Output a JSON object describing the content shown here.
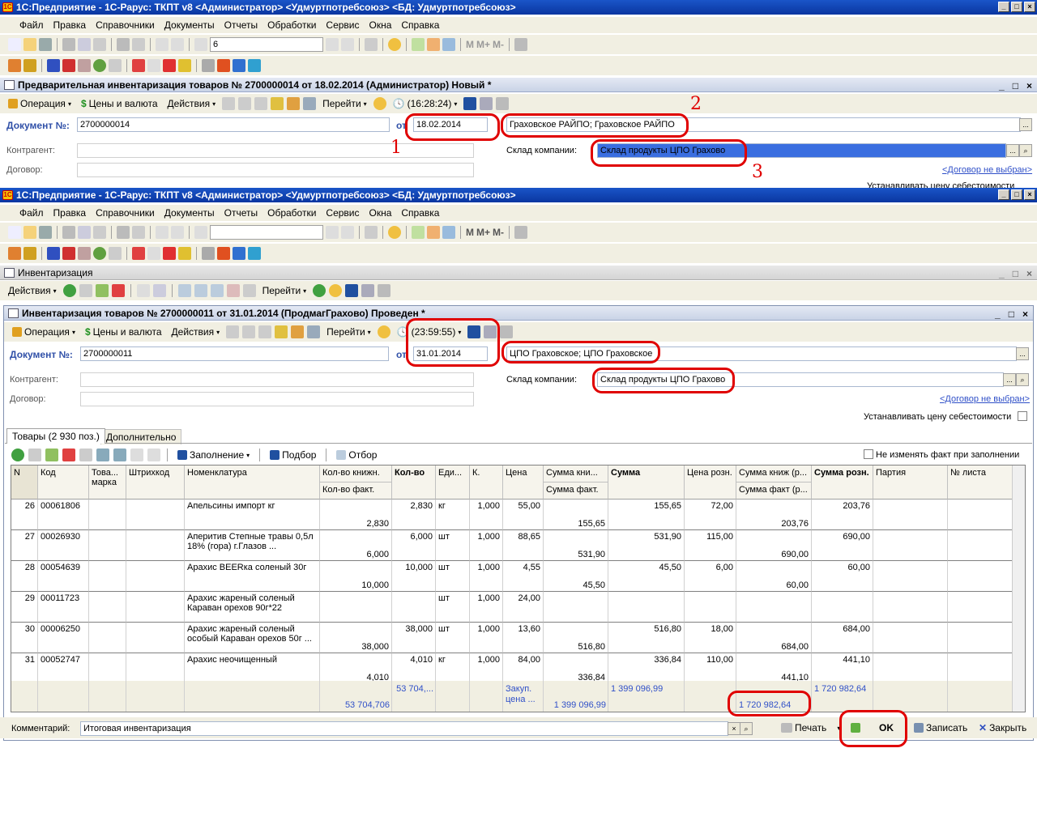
{
  "app": {
    "title1": "1С:Предприятие - 1С-Рарус: ТКПТ v8 <Администратор> <Удмуртпотребсоюз> <БД: Удмуртпотребсоюз>",
    "title2": "1С:Предприятие - 1С-Рарус: ТКПТ v8 <Администратор> <Удмуртпотребсоюз> <БД: Удмуртпотребсоюз>",
    "logo": "1С"
  },
  "menu": [
    "Файл",
    "Правка",
    "Справочники",
    "Документы",
    "Отчеты",
    "Обработки",
    "Сервис",
    "Окна",
    "Справка"
  ],
  "toolbar": {
    "combo1_value": "6",
    "m_labels": [
      "M",
      "M+",
      "M-"
    ]
  },
  "window_buttons": {
    "min": "_",
    "max": "□",
    "close": "×"
  },
  "doc1": {
    "title": "Предварительная инвентаризация товаров № 2700000014 от 18.02.2014 (Администратор) Новый *",
    "cmd": {
      "operation": "Операция",
      "prices": "Цены и валюта",
      "actions": "Действия",
      "goto": "Перейти",
      "time": "(16:28:24)"
    },
    "doc_label": "Документ №:",
    "doc_no": "2700000014",
    "from_label": "от",
    "date": "18.02.2014",
    "org": "Граховское РАЙПО; Граховское РАЙПО",
    "contractor_label": "Контрагент:",
    "contract_label": "Договор:",
    "warehouse_label": "Склад компании:",
    "warehouse": "Склад продукты ЦПО Грахово",
    "contract_link": "<Договор не выбран>",
    "cost_label": "Устанавливать цену себестоимости"
  },
  "annotations": {
    "n1": "1",
    "n2": "2",
    "n3": "3"
  },
  "list_window": {
    "title": "Инвентаризация",
    "actions": "Действия",
    "goto": "Перейти"
  },
  "doc2": {
    "title": "Инвентаризация товаров № 2700000011 от 31.01.2014 (ПродмагГрахово) Проведен *",
    "cmd": {
      "operation": "Операция",
      "prices": "Цены и валюта",
      "actions": "Действия",
      "goto": "Перейти",
      "time": "(23:59:55)"
    },
    "doc_label": "Документ №:",
    "doc_no": "2700000011",
    "from_label": "от",
    "date": "31.01.2014",
    "org": "ЦПО Граховское; ЦПО Граховское",
    "contractor_label": "Контрагент:",
    "contract_label": "Договор:",
    "warehouse_label": "Склад компании:",
    "warehouse": "Склад продукты ЦПО Грахово",
    "contract_link": "<Договор не выбран>",
    "cost_label": "Устанавливать цену себестоимости",
    "tabs": [
      "Товары (2 930 поз.)",
      "Дополнительно"
    ],
    "table_toolbar": {
      "fill": "Заполнение",
      "select": "Подбор",
      "filter": "Отбор",
      "no_change": "Не изменять факт при заполнении"
    },
    "columns": {
      "n": "N",
      "code": "Код",
      "mark": "Това... марка",
      "barcode": "Штрихкод",
      "nom": "Номенклатура",
      "qty_book": "Кол-во книжн.",
      "qty_fact": "Кол-во факт.",
      "qty": "Кол-во",
      "unit": "Еди...",
      "k": "К.",
      "price": "Цена",
      "sum_book": "Сумма кни...",
      "sum_fact": "Сумма факт.",
      "sum": "Сумма",
      "price_retail": "Цена розн.",
      "sum_book_r": "Сумма книж (р...",
      "sum_fact_r": "Сумма факт (р...",
      "sum_retail": "Сумма розн.",
      "batch": "Партия",
      "sheet": "№ листа"
    },
    "rows": [
      {
        "n": "26",
        "code": "00061806",
        "nom": "Апельсины импорт кг",
        "qty_book": "2,830",
        "qty": "2,830",
        "unit": "кг",
        "k": "1,000",
        "price": "55,00",
        "sum_book": "155,65",
        "sum": "155,65",
        "price_retail": "72,00",
        "sum_book_r": "203,76",
        "sum_retail": "203,76"
      },
      {
        "n": "27",
        "code": "00026930",
        "nom": "Аперитив Степные травы 0,5л 18% (гора) г.Глазов ...",
        "qty_book": "6,000",
        "qty": "6,000",
        "unit": "шт",
        "k": "1,000",
        "price": "88,65",
        "sum_book": "531,90",
        "sum": "531,90",
        "price_retail": "115,00",
        "sum_book_r": "690,00",
        "sum_retail": "690,00"
      },
      {
        "n": "28",
        "code": "00054639",
        "nom": "Арахис BEERка соленый 30г",
        "qty_book": "10,000",
        "qty": "10,000",
        "unit": "шт",
        "k": "1,000",
        "price": "4,55",
        "sum_book": "45,50",
        "sum": "45,50",
        "price_retail": "6,00",
        "sum_book_r": "60,00",
        "sum_retail": "60,00"
      },
      {
        "n": "29",
        "code": "00011723",
        "nom": "Арахис жареный соленый Караван орехов 90г*22",
        "qty_book": "",
        "qty": "",
        "unit": "шт",
        "k": "1,000",
        "price": "24,00",
        "sum_book": "",
        "sum": "",
        "price_retail": "",
        "sum_book_r": "",
        "sum_retail": ""
      },
      {
        "n": "30",
        "code": "00006250",
        "nom": "Арахис жареный соленый особый Караван орехов 50г ...",
        "qty_book": "38,000",
        "qty": "38,000",
        "unit": "шт",
        "k": "1,000",
        "price": "13,60",
        "sum_book": "516,80",
        "sum": "516,80",
        "price_retail": "18,00",
        "sum_book_r": "684,00",
        "sum_retail": "684,00"
      },
      {
        "n": "31",
        "code": "00052747",
        "nom": "Арахис неочищенный",
        "qty_book": "4,010",
        "qty": "4,010",
        "unit": "кг",
        "k": "1,000",
        "price": "84,00",
        "sum_book": "336,84",
        "sum": "336,84",
        "price_retail": "110,00",
        "sum_book_r": "441,10",
        "sum_retail": "441,10"
      }
    ],
    "footer": {
      "qty_top": "53 704,...",
      "qty_bottom": "53 704,706",
      "price_note": "Закуп. цена ...",
      "sum_book": "1 399 096,99",
      "sum": "1 399 096,99",
      "sum_fact_r": "1 720 982,64",
      "sum_retail": "1 720 982,64"
    },
    "comment_label": "Комментарий:",
    "comment": "Итоговая инвентаризация",
    "print": "Печать",
    "ok": "OK",
    "save": "Записать",
    "close": "Закрыть"
  },
  "colors": {
    "title_bar": "#0a36a0",
    "annotation": "#e00000",
    "link": "#3050c8",
    "selection": "#3a6ee0"
  }
}
